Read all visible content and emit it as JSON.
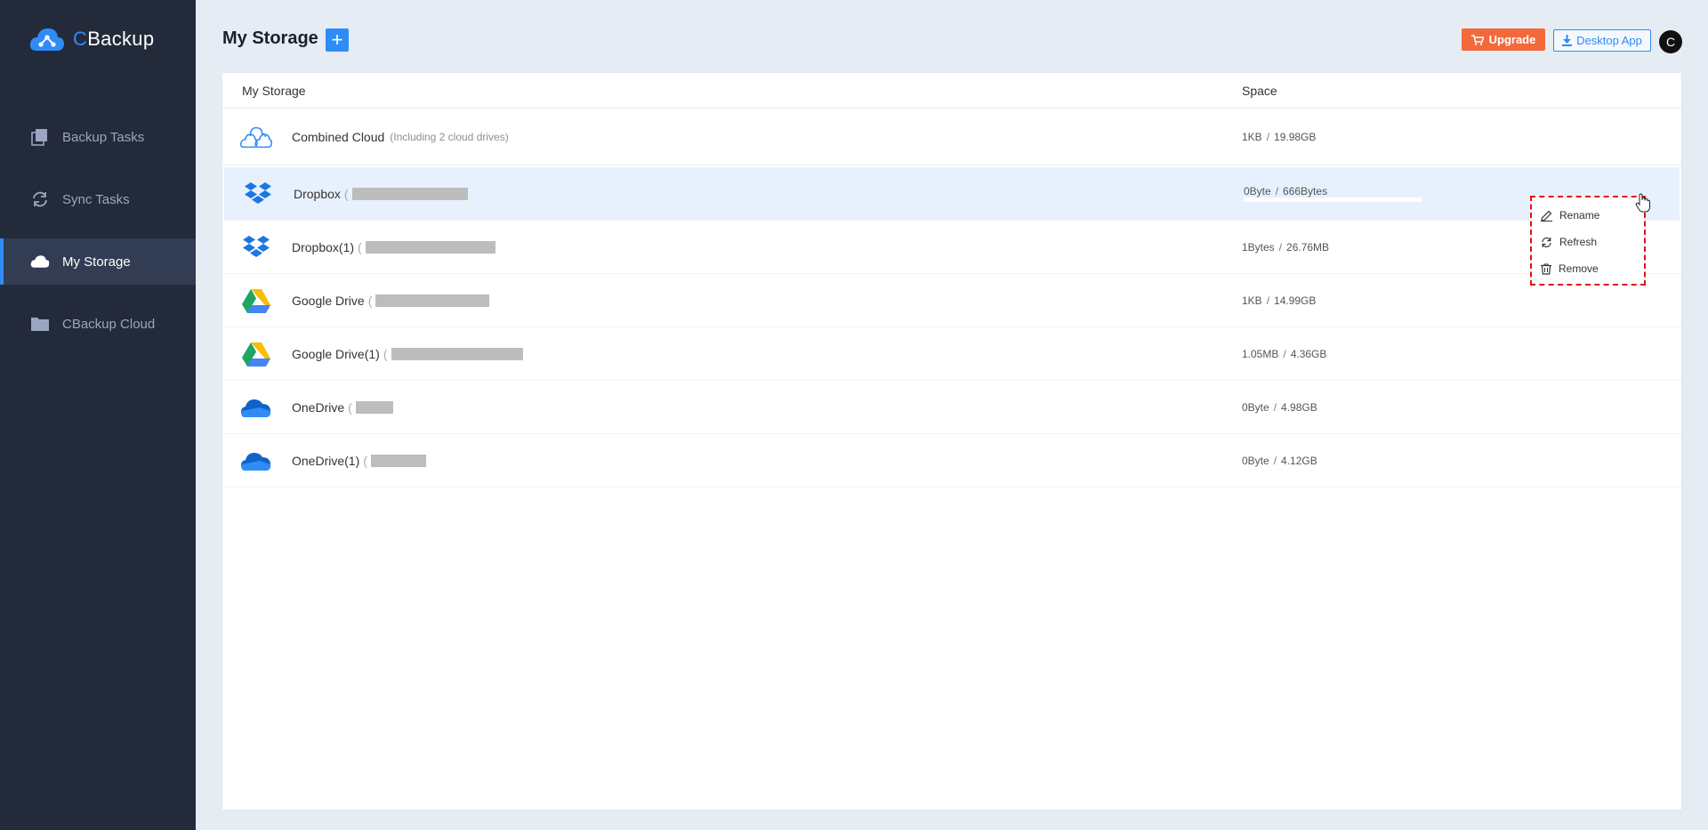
{
  "app": {
    "brand_prefix": "C",
    "brand_rest": "Backup"
  },
  "sidebar": {
    "items": [
      {
        "label": "Backup Tasks",
        "icon": "copy-icon",
        "active": false
      },
      {
        "label": "Sync Tasks",
        "icon": "sync-icon",
        "active": false
      },
      {
        "label": "My Storage",
        "icon": "cloud-icon",
        "active": true
      },
      {
        "label": "CBackup Cloud",
        "icon": "folder-icon",
        "active": false
      }
    ]
  },
  "header": {
    "title": "My Storage",
    "add_label": "+",
    "upgrade_label": "Upgrade",
    "desktop_label": "Desktop App",
    "avatar_letter": "C"
  },
  "table": {
    "col_name": "My Storage",
    "col_space": "Space",
    "rows": [
      {
        "name": "Combined Cloud",
        "sub": "(Including 2 cloud drives)",
        "used": "1KB",
        "total": "19.98GB",
        "icon": "combined-cloud-icon"
      },
      {
        "name": "Dropbox",
        "paren": "(",
        "used": "0Byte",
        "total": "666Bytes",
        "icon": "dropbox-icon"
      },
      {
        "name": "Dropbox(1)",
        "paren": "(",
        "used": "1Bytes",
        "total": "26.76MB",
        "icon": "dropbox-icon"
      },
      {
        "name": "Google Drive",
        "paren": "(",
        "used": "1KB",
        "total": "14.99GB",
        "icon": "google-drive-icon"
      },
      {
        "name": "Google Drive(1)",
        "paren": "(",
        "used": "1.05MB",
        "total": "4.36GB",
        "icon": "google-drive-icon"
      },
      {
        "name": "OneDrive",
        "paren": "(",
        "used": "0Byte",
        "total": "4.98GB",
        "icon": "onedrive-icon"
      },
      {
        "name": "OneDrive(1)",
        "paren": "(",
        "used": "0Byte",
        "total": "4.12GB",
        "icon": "onedrive-icon"
      }
    ],
    "separator": "/"
  },
  "context_menu": {
    "items": [
      {
        "label": "Rename",
        "icon": "pencil-icon"
      },
      {
        "label": "Refresh",
        "icon": "refresh-icon"
      },
      {
        "label": "Remove",
        "icon": "trash-icon"
      }
    ]
  },
  "colors": {
    "accent": "#2f8cf7",
    "upgrade": "#f4693b",
    "sidebar": "#232a3a",
    "highlight": "#e0121b"
  }
}
